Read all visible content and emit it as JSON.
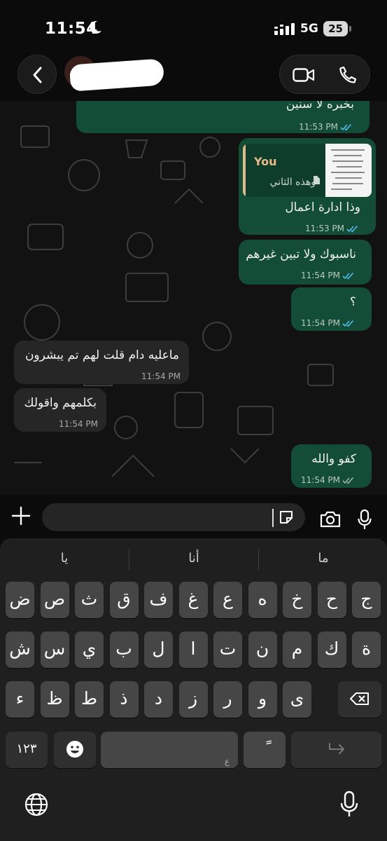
{
  "status_bar": {
    "time": "11:54",
    "network": "5G",
    "battery": "25"
  },
  "header": {
    "contact_name": "",
    "back_icon": "chevron-left-icon",
    "video_icon": "video-icon",
    "call_icon": "phone-icon"
  },
  "messages": [
    {
      "direction": "out",
      "text": "بخبره لا سنين",
      "time": "11:53 PM",
      "status": "read"
    },
    {
      "direction": "out",
      "reply": {
        "author": "You",
        "caption": "وهذه الثاني"
      },
      "text": "وذا ادارة اعمال",
      "time": "11:53 PM",
      "status": "read"
    },
    {
      "direction": "out",
      "text": "ناسبوك ولا تبين غيرهم",
      "time": "11:54 PM",
      "status": "read"
    },
    {
      "direction": "out",
      "text": "؟",
      "time": "11:54 PM",
      "status": "read"
    },
    {
      "direction": "in",
      "text": "ماعليه دام قلت لهم تم يبشرون",
      "time": "11:54 PM"
    },
    {
      "direction": "in",
      "text": "بكلمهم واقولك",
      "time": "11:54 PM"
    },
    {
      "direction": "out",
      "text": "كفو والله",
      "time": "11:54 PM",
      "status": "delivered"
    }
  ],
  "input": {
    "placeholder": "",
    "icons": [
      "plus-icon",
      "sticker-icon",
      "camera-icon",
      "microphone-icon"
    ]
  },
  "keyboard": {
    "suggestions": [
      "يا",
      "أنا",
      "ما"
    ],
    "row1": [
      "ض",
      "ص",
      "ث",
      "ق",
      "ف",
      "غ",
      "ع",
      "ه",
      "خ",
      "ح",
      "ج"
    ],
    "row2": [
      "ش",
      "س",
      "ي",
      "ب",
      "ل",
      "ا",
      "ت",
      "ن",
      "م",
      "ك",
      "ة"
    ],
    "row3": [
      "ء",
      "ظ",
      "ط",
      "ذ",
      "د",
      "ز",
      "ر",
      "و",
      "ى"
    ],
    "numbers_key": "١٢٣",
    "space_hint": "ع",
    "tanween_key": "ً",
    "icons": [
      "backspace-icon",
      "emoji-icon",
      "return-icon",
      "globe-icon",
      "microphone-icon"
    ]
  },
  "colors": {
    "outgoing_bubble": "#134d37",
    "incoming_bubble": "#262626",
    "read_tick": "#53bdeb",
    "reply_author": "#e6b88a"
  }
}
